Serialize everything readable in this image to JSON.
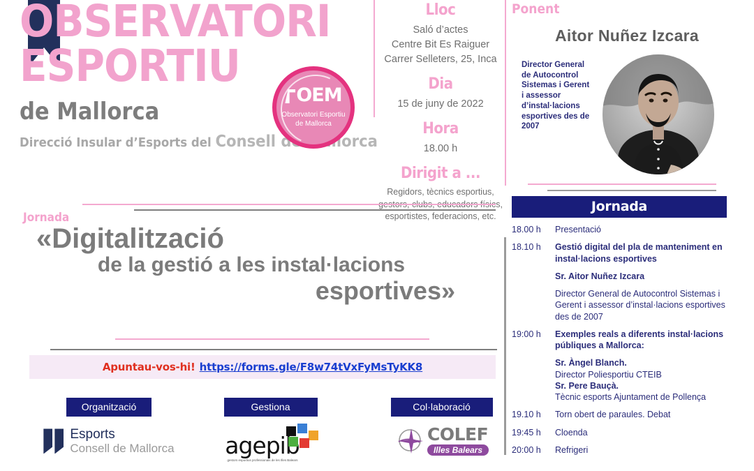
{
  "brand": {
    "title_line1": "OBSERVATORI",
    "title_line2": "ESPORTIU",
    "subtitle": "de Mallorca",
    "org_prefix": "Direcció Insular d’Esports del ",
    "org_strong": "Consell de Mallorca",
    "colors": {
      "pink": "#f2a3cd",
      "magenta": "#e4327f",
      "navy": "#191d7a",
      "dark_navy": "#22305c",
      "gray": "#7b7b7b"
    }
  },
  "badge": {
    "mark": "OEM",
    "line1": "Observatori Esportiu",
    "line2": "de Mallorca"
  },
  "info": {
    "place_head": "Lloc",
    "place_lines": [
      "Saló d’actes",
      "Centre Bit  Es Raiguer",
      "Carrer Selleters, 25, Inca"
    ],
    "day_head": "Dia",
    "day_value": "15 de juny de 2022",
    "time_head": "Hora",
    "time_value": "18.00 h",
    "target_head": "Dirigit  a ...",
    "target_lines": [
      "Regidors, tècnics esportius,",
      "gestors, clubs, educadors físics,",
      "esportistes, federacions, etc."
    ]
  },
  "speaker": {
    "label": "Ponent",
    "name": "Aitor Nuñez Izcara",
    "bio": "Director General de Autocontrol Sistemas i Gerent i assessor d’instal·lacions esportives des de 2007",
    "photo_alt": "speaker-portrait"
  },
  "schedule": {
    "heading": "Jornada",
    "rows": [
      {
        "time": "18.00 h",
        "items": [
          {
            "text": "Presentació",
            "style": "norm"
          }
        ]
      },
      {
        "time": "18.10 h",
        "items": [
          {
            "text": "Gestió digital del pla de manteniment en instal·lacions esportives",
            "style": "bold"
          },
          {
            "text": "Sr. Aitor Nuñez Izcara",
            "style": "bold-gap"
          },
          {
            "text": "Director General de Autocontrol Sistemas i Gerent i assessor d’instal·lacions esportives des de 2007",
            "style": "norm-gap"
          }
        ]
      },
      {
        "time": "19:00 h",
        "items": [
          {
            "text": "Exemples reals a diferents instal·lacions públiques a Mallorca:",
            "style": "bold"
          },
          {
            "text": "Sr. Àngel Blanch.",
            "style": "bold-gap"
          },
          {
            "text": "Director Poliesportiu CTEIB",
            "style": "norm"
          },
          {
            "text": "Sr. Pere Bauçà.",
            "style": "bold"
          },
          {
            "text": "Tècnic esports Ajuntament de  Pollença",
            "style": "norm"
          }
        ]
      },
      {
        "time": "19.10 h",
        "items": [
          {
            "text": "Torn obert de paraules. Debat",
            "style": "norm"
          }
        ]
      },
      {
        "time": "19:45 h",
        "items": [
          {
            "text": "Cloenda",
            "style": "norm"
          }
        ]
      },
      {
        "time": "20:00 h",
        "items": [
          {
            "text": "Refrigeri",
            "style": "norm"
          }
        ]
      }
    ]
  },
  "topic": {
    "label": "Jornada",
    "line1": "«Digitalització",
    "line2": "de la gestió a les instal·lacions",
    "line3": "esportives»"
  },
  "signup": {
    "call_to_action": "Apuntau-vos-hi!",
    "url": "https://forms.gle/F8w74tVxFyMsTyKK8"
  },
  "footer": {
    "groups": [
      {
        "chip": "Organització",
        "logo": "esports-consell-de-mallorca",
        "logo_line1": "Esports",
        "logo_line2": "Consell de Mallorca"
      },
      {
        "chip": "Gestiona",
        "logo": "agepib",
        "logo_word": "agepib",
        "logo_tagline": "gestors esportius professionals de les Illes Balears"
      },
      {
        "chip": "Col·laboració",
        "logo": "colef-illes-balears",
        "logo_word": "COLEF",
        "logo_tagline": "Illes Balears"
      }
    ]
  }
}
